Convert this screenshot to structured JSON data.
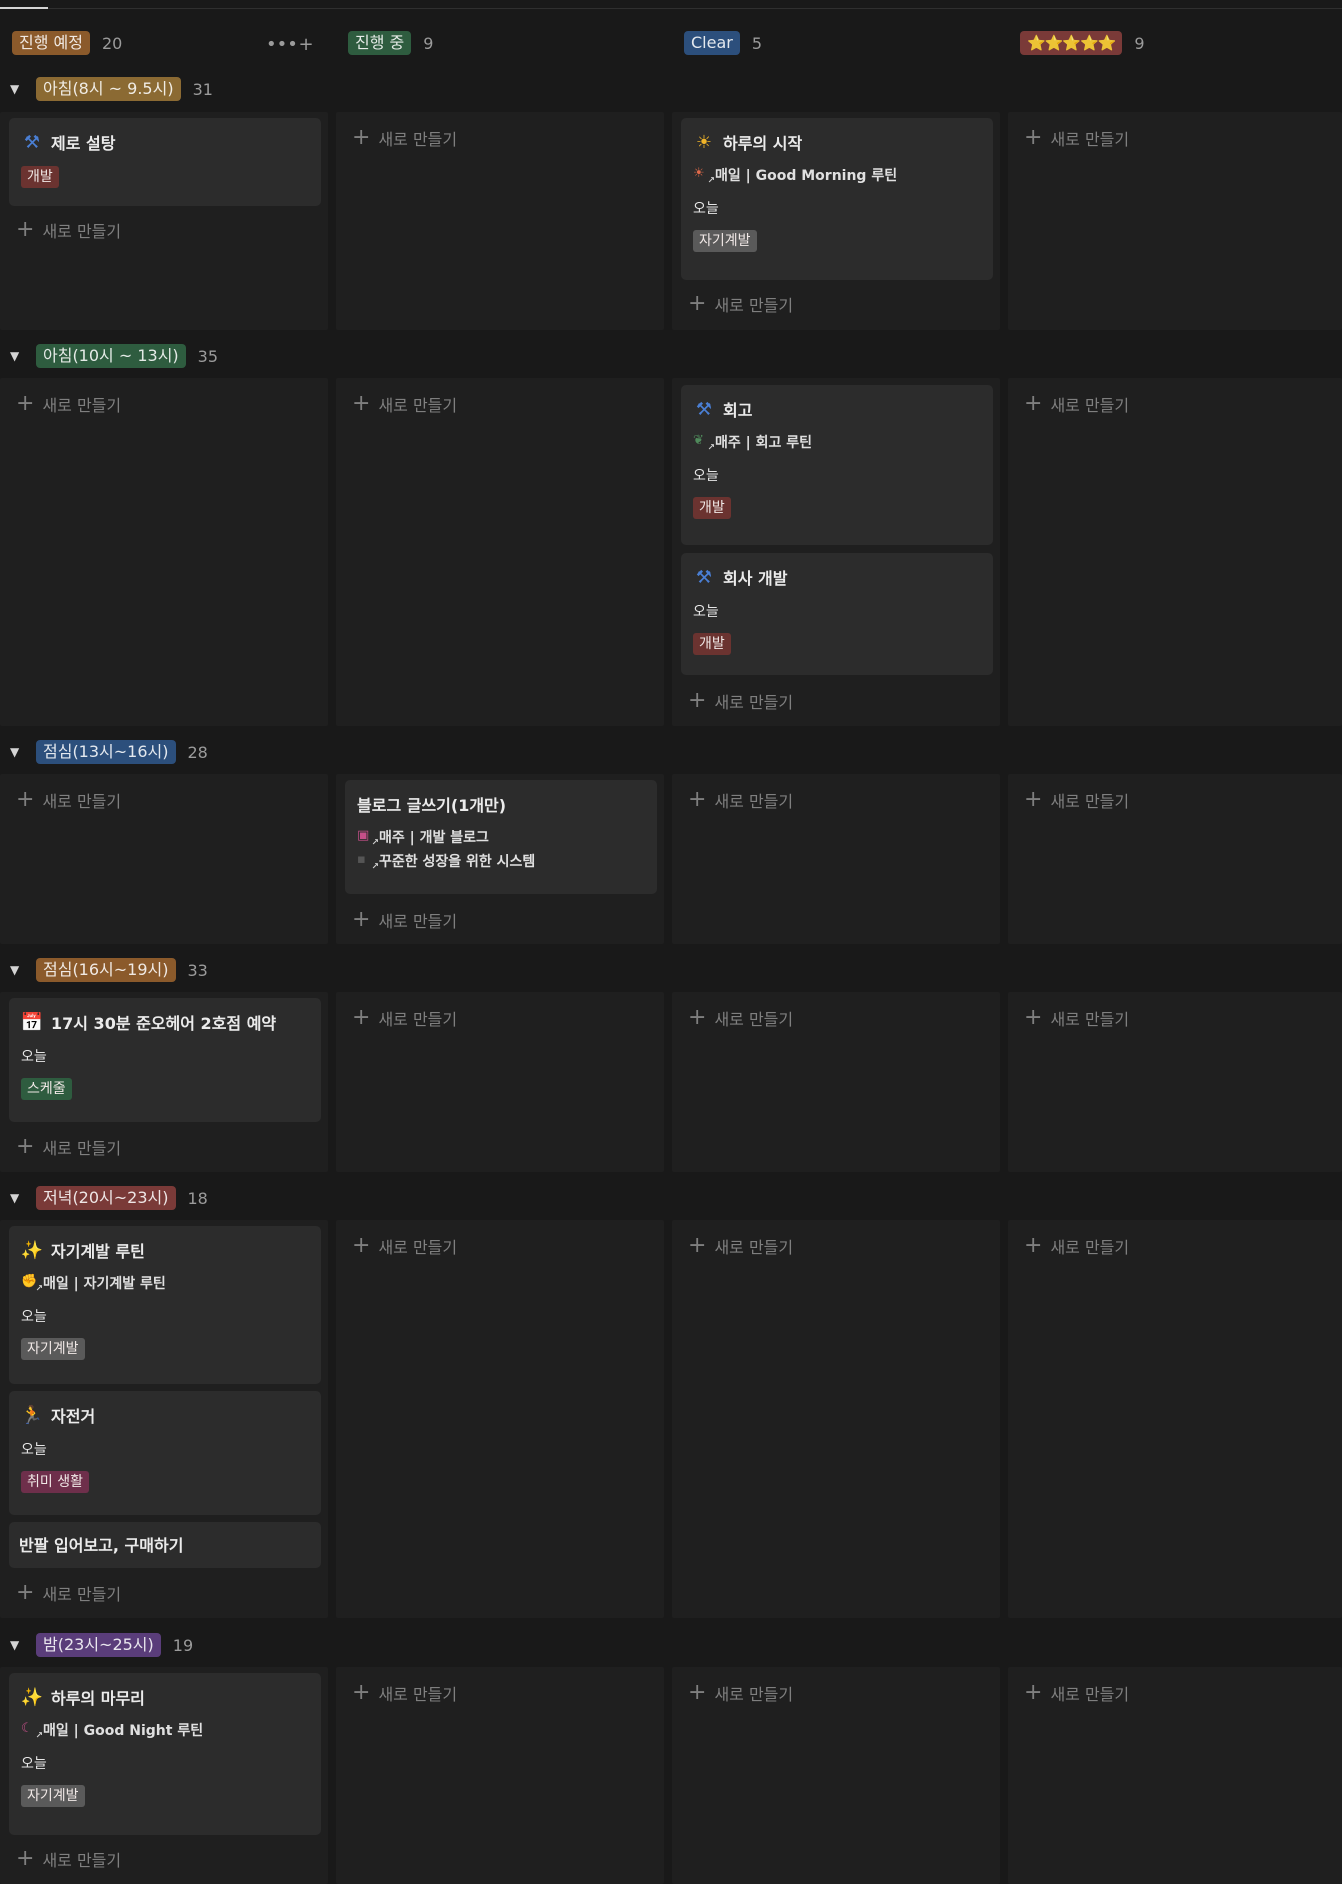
{
  "columns": [
    {
      "label": "진행 예정",
      "count": "20",
      "color": "#8b5a2b"
    },
    {
      "label": "진행 중",
      "count": "9",
      "color": "#2e5c3f"
    },
    {
      "label": "Clear",
      "count": "5",
      "color": "#2c4f7c"
    },
    {
      "label": "⭐⭐⭐⭐⭐",
      "count": "9",
      "color": "#7a3a38"
    }
  ],
  "column_actions": {
    "more_icon": "more-dots-icon",
    "add_icon": "plus-icon"
  },
  "new_label": "새로 만들기",
  "groups": [
    {
      "label": "아침(8시 ~ 9.5시)",
      "count": "31",
      "color": "#8b6a33"
    },
    {
      "label": "아침(10시 ~ 13시)",
      "count": "35",
      "color": "#2e5c3f"
    },
    {
      "label": "점심(13시~16시)",
      "count": "28",
      "color": "#2c4f7c"
    },
    {
      "label": "점심(16시~19시)",
      "count": "33",
      "color": "#8b5a2b"
    },
    {
      "label": "저녁(20시~23시)",
      "count": "18",
      "color": "#7a3a38"
    },
    {
      "label": "밤(23시~25시)",
      "count": "19",
      "color": "#5a3d7a"
    }
  ],
  "cards": {
    "c1": {
      "title": "제로 설탕",
      "icon": "hammer-icon",
      "tag": "개발",
      "tag_color": "#6b3330"
    },
    "c2": {
      "title": "하루의 시작",
      "icon": "sun-icon",
      "relation": "매일 | Good Morning 루틴",
      "date": "오늘",
      "tag": "자기계발",
      "tag_color": "#5a5a5a"
    },
    "c3": {
      "title": "회고",
      "icon": "hammer-icon",
      "relation": "매주 | 회고 루틴",
      "date": "오늘",
      "tag": "개발",
      "tag_color": "#6b3330"
    },
    "c4": {
      "title": "회사 개발",
      "icon": "hammer-icon",
      "date": "오늘",
      "tag": "개발",
      "tag_color": "#6b3330"
    },
    "c5": {
      "title": "블로그 글쓰기(1개만)",
      "relation": "매주 | 개발 블로그",
      "relation2": "꾸준한 성장을 위한 시스템"
    },
    "c6": {
      "title": "17시 30분 준오헤어 2호점 예약",
      "icon": "calendar-icon",
      "date": "오늘",
      "tag": "스케줄",
      "tag_color": "#2e5c3f"
    },
    "c7": {
      "title": "자기계발 루틴",
      "icon": "sparkles-icon",
      "relation": "매일 | 자기계발 루틴",
      "date": "오늘",
      "tag": "자기계발",
      "tag_color": "#5a5a5a"
    },
    "c8": {
      "title": "자전거",
      "icon": "runner-icon",
      "date": "오늘",
      "tag": "취미 생활",
      "tag_color": "#6e2f4b"
    },
    "c9": {
      "title": "반팔 입어보고, 구매하기"
    },
    "c10": {
      "title": "하루의 마무리",
      "icon": "sparkles-icon",
      "relation": "매일 | Good Night 루틴",
      "date": "오늘",
      "tag": "자기계발",
      "tag_color": "#5a5a5a"
    }
  }
}
